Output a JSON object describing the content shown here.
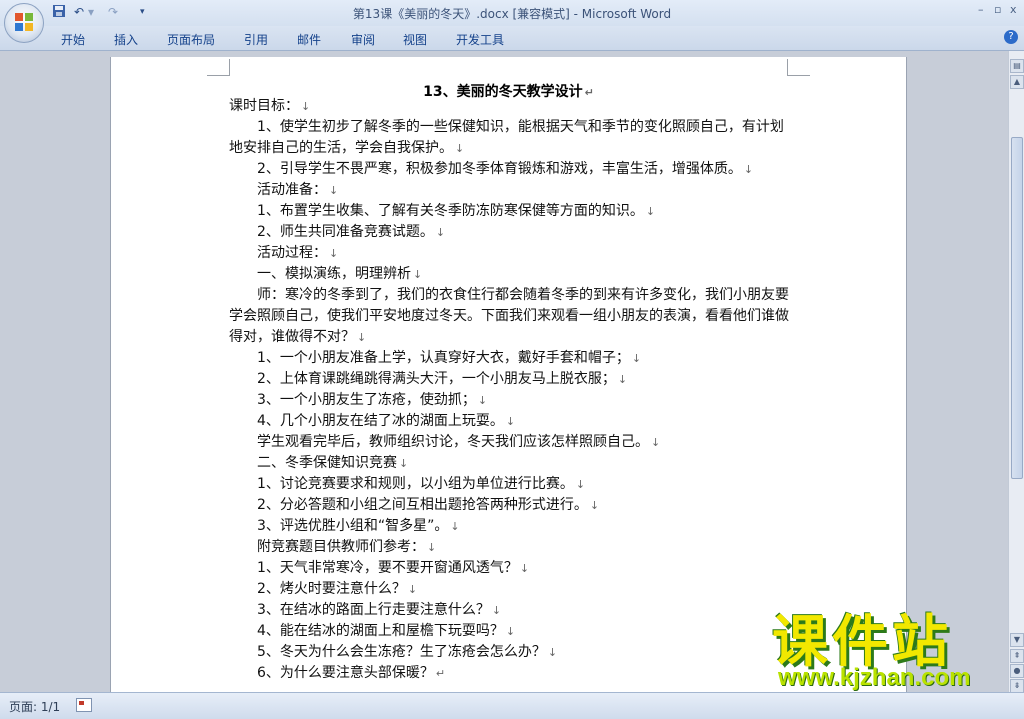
{
  "window": {
    "title": "第13课《美丽的冬天》.docx [兼容模式] - Microsoft Word",
    "controls": [
      "–",
      "▫",
      "x"
    ]
  },
  "quick_access": {
    "save_icon": "save-icon",
    "undo_icon": "undo-icon",
    "redo_icon": "redo-icon",
    "customize_icon": "customize-toolbar-icon"
  },
  "ribbon": {
    "tabs": [
      "开始",
      "插入",
      "页面布局",
      "引用",
      "邮件",
      "审阅",
      "视图",
      "开发工具"
    ],
    "help_label": "?"
  },
  "document": {
    "title": "13、美丽的冬天教学设计",
    "paragraph_mark": "↵",
    "line_mark": "↓",
    "lines": [
      "课时目标：",
      "1、使学生初步了解冬季的一些保健知识，能根据天气和季节的变化照顾自己，有计划",
      "地安排自己的生活，学会自我保护。",
      "2、引导学生不畏严寒，积极参加冬季体育锻炼和游戏，丰富生活，增强体质。",
      "活动准备：",
      "1、布置学生收集、了解有关冬季防冻防寒保健等方面的知识。",
      "2、师生共同准备竞赛试题。",
      "活动过程：",
      "一、模拟演练，明理辨析",
      "师：寒冷的冬季到了，我们的衣食住行都会随着冬季的到来有许多变化，我们小朋友要",
      "学会照顾自己，使我们平安地度过冬天。下面我们来观看一组小朋友的表演，看看他们谁做",
      "得对，谁做得不对？",
      "1、一个小朋友准备上学，认真穿好大衣，戴好手套和帽子；",
      "2、上体育课跳绳跳得满头大汗，一个小朋友马上脱衣服；",
      "3、一个小朋友生了冻疮，使劲抓；",
      "4、几个小朋友在结了冰的湖面上玩耍。",
      "学生观看完毕后，教师组织讨论，冬天我们应该怎样照顾自己。",
      "二、冬季保健知识竞赛",
      "1、讨论竞赛要求和规则，以小组为单位进行比赛。",
      "2、分必答题和小组之间互相出题抢答两种形式进行。",
      "3、评选优胜小组和“智多星”。",
      "附竞赛题目供教师们参考：",
      "1、天气非常寒冷，要不要开窗通风透气？",
      "2、烤火时要注意什么？",
      "3、在结冰的路面上行走要注意什么？",
      "4、能在结冰的湖面上和屋檐下玩耍吗？",
      "5、冬天为什么会生冻疮？生了冻疮会怎么办？",
      "6、为什么要注意头部保暖？"
    ]
  },
  "statusbar": {
    "page_label": "页面: 1/1"
  },
  "watermark": {
    "brand": "课件站",
    "url": "www.kjzhan.com"
  }
}
